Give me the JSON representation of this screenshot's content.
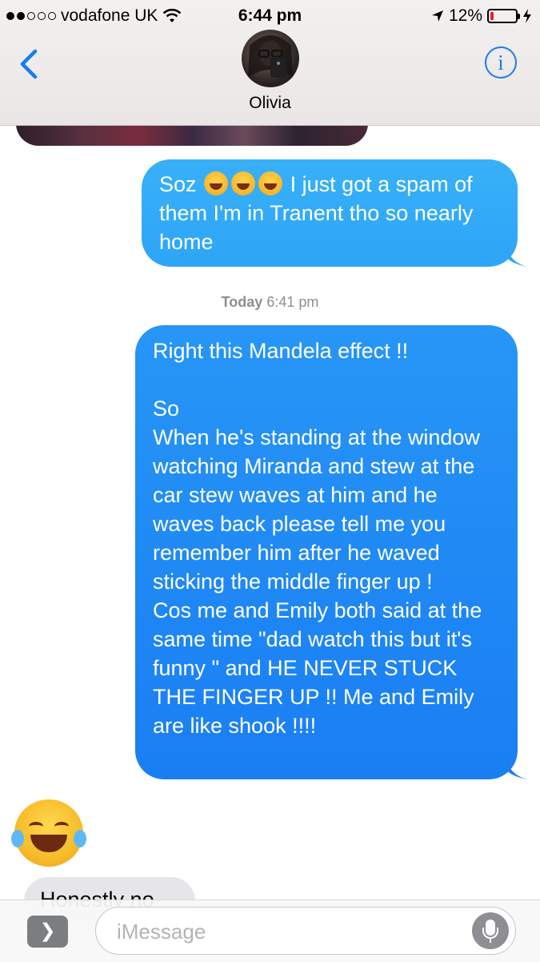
{
  "status_bar": {
    "carrier": "vodafone UK",
    "time": "6:44 pm",
    "battery_percent": "12%",
    "signal_bars_filled": 2,
    "signal_bars_total": 5,
    "battery_level": 0.12,
    "battery_color": "#e3212b"
  },
  "header": {
    "contact_name": "Olivia",
    "info_label": "i"
  },
  "messages": {
    "sent_1": {
      "part1": "Soz",
      "part2": "I just got a spam of them I'm in Tranent tho so nearly home"
    },
    "timestamp": {
      "day": "Today",
      "time": "6:41 pm"
    },
    "sent_2": {
      "text": "Right this Mandela effect !!\n\nSo\nWhen he's standing at the window watching Miranda and stew at the car stew waves at him and he waves back please tell me you remember him after he waved sticking the middle finger up !\nCos me and Emily both said at the same time \"dad watch this but it's funny \" and HE NEVER STUCK THE FINGER UP !! Me and Emily are like shook !!!!"
    },
    "received_partial": {
      "text": "Honestly no"
    }
  },
  "input_bar": {
    "apps_label": "❯",
    "placeholder": "iMessage"
  },
  "colors": {
    "accent": "#1a7bf2",
    "sent_bubble": "#1a7ef3",
    "received_bubble": "#e6e5ea"
  }
}
